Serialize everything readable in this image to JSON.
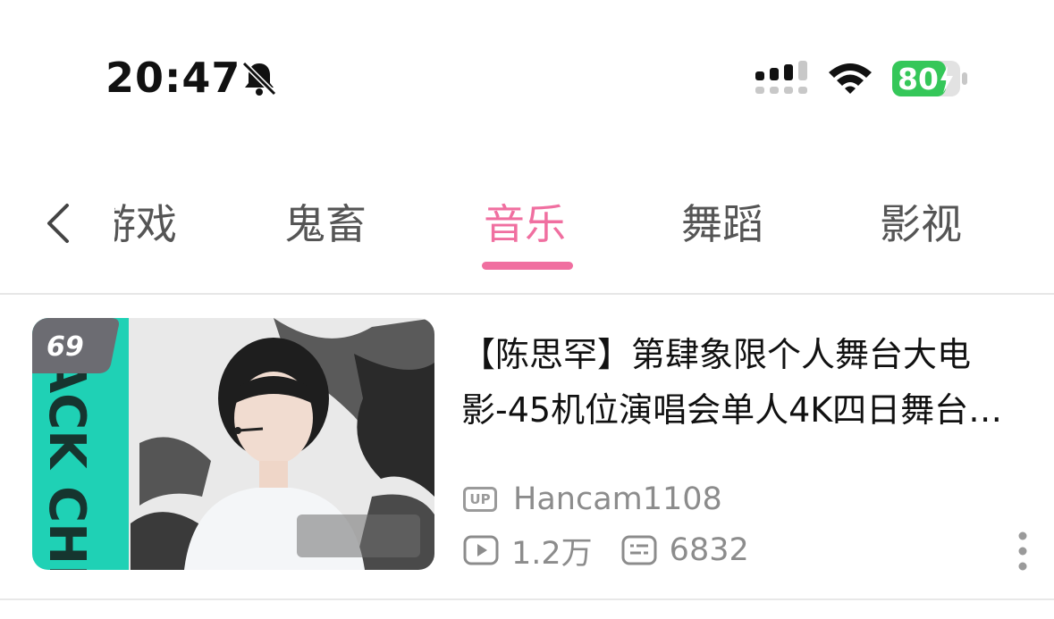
{
  "status_bar": {
    "time": "20:47",
    "battery": "80",
    "icons": [
      "bell-slash-icon",
      "cellular-signal-icon",
      "wifi-icon",
      "battery-charging-icon"
    ]
  },
  "tabs": {
    "partial_label": "游戏",
    "items": [
      {
        "label": "鬼畜",
        "active": false
      },
      {
        "label": "音乐",
        "active": true
      },
      {
        "label": "舞蹈",
        "active": false
      },
      {
        "label": "影视",
        "active": false
      }
    ],
    "accent_color": "#f06fa0"
  },
  "video": {
    "badge": "69",
    "thumbnail_text": "JACK CHEN",
    "title": "【陈思罕】第肆象限个人舞台大电影-45机位演唱会单人4K四日舞台…",
    "up_badge": "UP",
    "uploader": "Hancam1108",
    "views": "1.2万",
    "danmaku": "6832"
  }
}
